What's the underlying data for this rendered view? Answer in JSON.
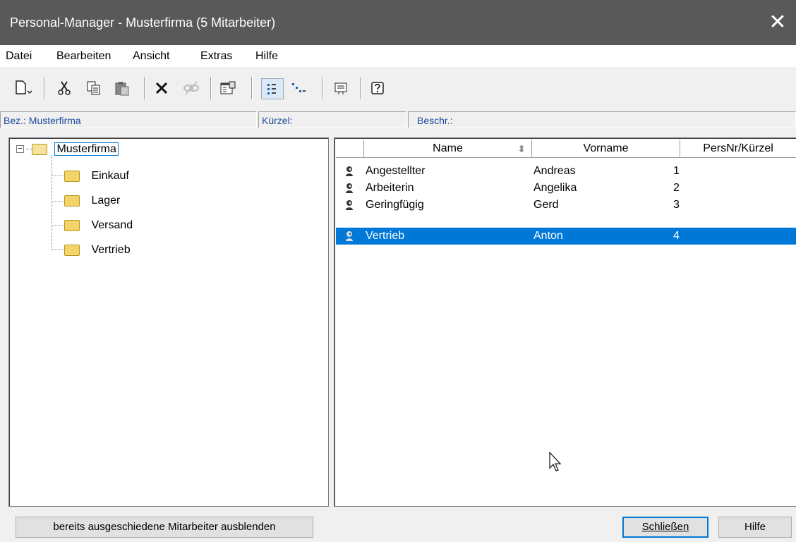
{
  "window": {
    "title": "Personal-Manager - Musterfirma (5 Mitarbeiter)",
    "close_glyph": "✕"
  },
  "menu": [
    "Datei",
    "Bearbeiten",
    "Ansicht",
    "Extras",
    "Hilfe"
  ],
  "toolbar": {
    "icons": [
      "new-document-icon",
      "cut-icon",
      "copy-icon",
      "paste-icon",
      "delete-icon",
      "unlink-icon",
      "properties-icon",
      "tree-view-icon",
      "detail-view-icon",
      "export-icon",
      "help-icon"
    ]
  },
  "info": {
    "bez": "Bez.: Musterfirma",
    "kuerzel": "Kürzel:",
    "beschr": "Beschr.:"
  },
  "tree": {
    "root": "Musterfirma",
    "root_expander": "−",
    "children": [
      "Einkauf",
      "Lager",
      "Versand",
      "Vertrieb"
    ]
  },
  "list": {
    "columns": [
      "Name",
      "Vorname",
      "PersNr/Kürzel"
    ],
    "sort_indicator": "⬍",
    "rows": [
      {
        "name": "Angestellter",
        "vorname": "Andreas",
        "persnr": "1"
      },
      {
        "name": "Arbeiterin",
        "vorname": "Angelika",
        "persnr": "2"
      },
      {
        "name": "Geringfügig",
        "vorname": "Gerd",
        "persnr": "3"
      },
      {
        "name": "Vertrieb",
        "vorname": "Anton",
        "persnr": "4"
      }
    ],
    "selected_index": 3
  },
  "buttons": {
    "hide_former": "bereits ausgeschiedene Mitarbeiter ausblenden",
    "close": "Schließen",
    "help": "Hilfe"
  },
  "colors": {
    "selection": "#0078d7",
    "titlebar": "#595959",
    "info_text": "#1a4a9c"
  }
}
